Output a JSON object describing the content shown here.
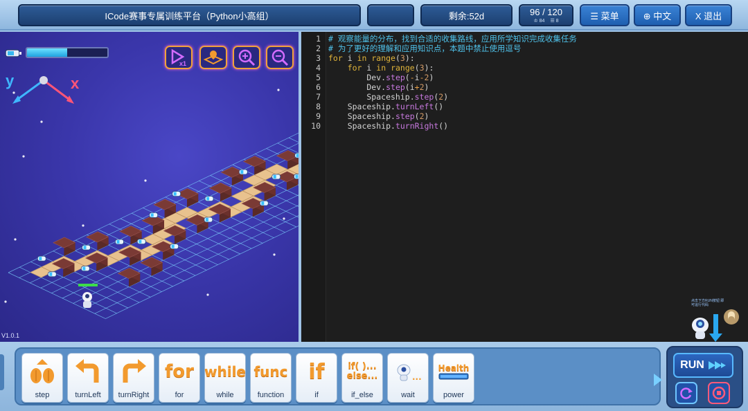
{
  "topbar": {
    "title": "ICode赛事专属训练平台（Python小高组）",
    "remaining": "剩余:52d",
    "score": {
      "main": "96 / 120",
      "sub_a": "84",
      "sub_b": "8",
      "sub_a_icon": "trophy-icon",
      "sub_b_icon": "list-icon"
    },
    "menu_label": "☰ 菜单",
    "lang_label": "⊕ 中文",
    "exit_label": "X 退出"
  },
  "game": {
    "version": "V1.0.1",
    "axis_y": "y",
    "axis_x": "x",
    "energy_level": 0.5,
    "buttons": [
      "reset-view-icon",
      "map-icon",
      "zoom-in-icon",
      "zoom-out-icon"
    ],
    "colors": {
      "background": "#3a36aa",
      "grid": "#7fd6ff",
      "path": "#e8c28e",
      "wall": "#7a3a35",
      "energy_bar": "#1fa2e0"
    }
  },
  "editor": {
    "lines": [
      {
        "n": "1",
        "text": "# 观察能量的分布，找到合适的收集路线，应用所学知识完成收集任务"
      },
      {
        "n": "2",
        "text": "# 为了更好的理解和应用知识点，本题中禁止使用逗号"
      },
      {
        "n": "3",
        "text": "for i in range(3):"
      },
      {
        "n": "4",
        "text": "    for i in range(3):"
      },
      {
        "n": "5",
        "text": "        Dev.step(-i-2)"
      },
      {
        "n": "6",
        "text": "        Dev.step(i+2)"
      },
      {
        "n": "7",
        "text": "        Spaceship.step(2)"
      },
      {
        "n": "8",
        "text": "    Spaceship.turnLeft()"
      },
      {
        "n": "9",
        "text": "    Spaceship.step(2)"
      },
      {
        "n": "10",
        "text": "    Spaceship.turnRight()"
      }
    ],
    "helper_hint": "点击下方RUN按钮 即可运行代码"
  },
  "blocks": [
    {
      "label": "step",
      "glyph": "step-icon"
    },
    {
      "label": "turnLeft",
      "glyph": "turn-left-icon"
    },
    {
      "label": "turnRight",
      "glyph": "turn-right-icon"
    },
    {
      "label": "for",
      "glyph": "for"
    },
    {
      "label": "while",
      "glyph": "while"
    },
    {
      "label": "function",
      "glyph": "func"
    },
    {
      "label": "if",
      "glyph": "if"
    },
    {
      "label": "if_else",
      "glyph_top": "if( )...",
      "glyph_bottom": "else..."
    },
    {
      "label": "wait",
      "glyph": "..."
    },
    {
      "label": "power",
      "glyph": "Health"
    }
  ],
  "run": {
    "label": "RUN"
  }
}
